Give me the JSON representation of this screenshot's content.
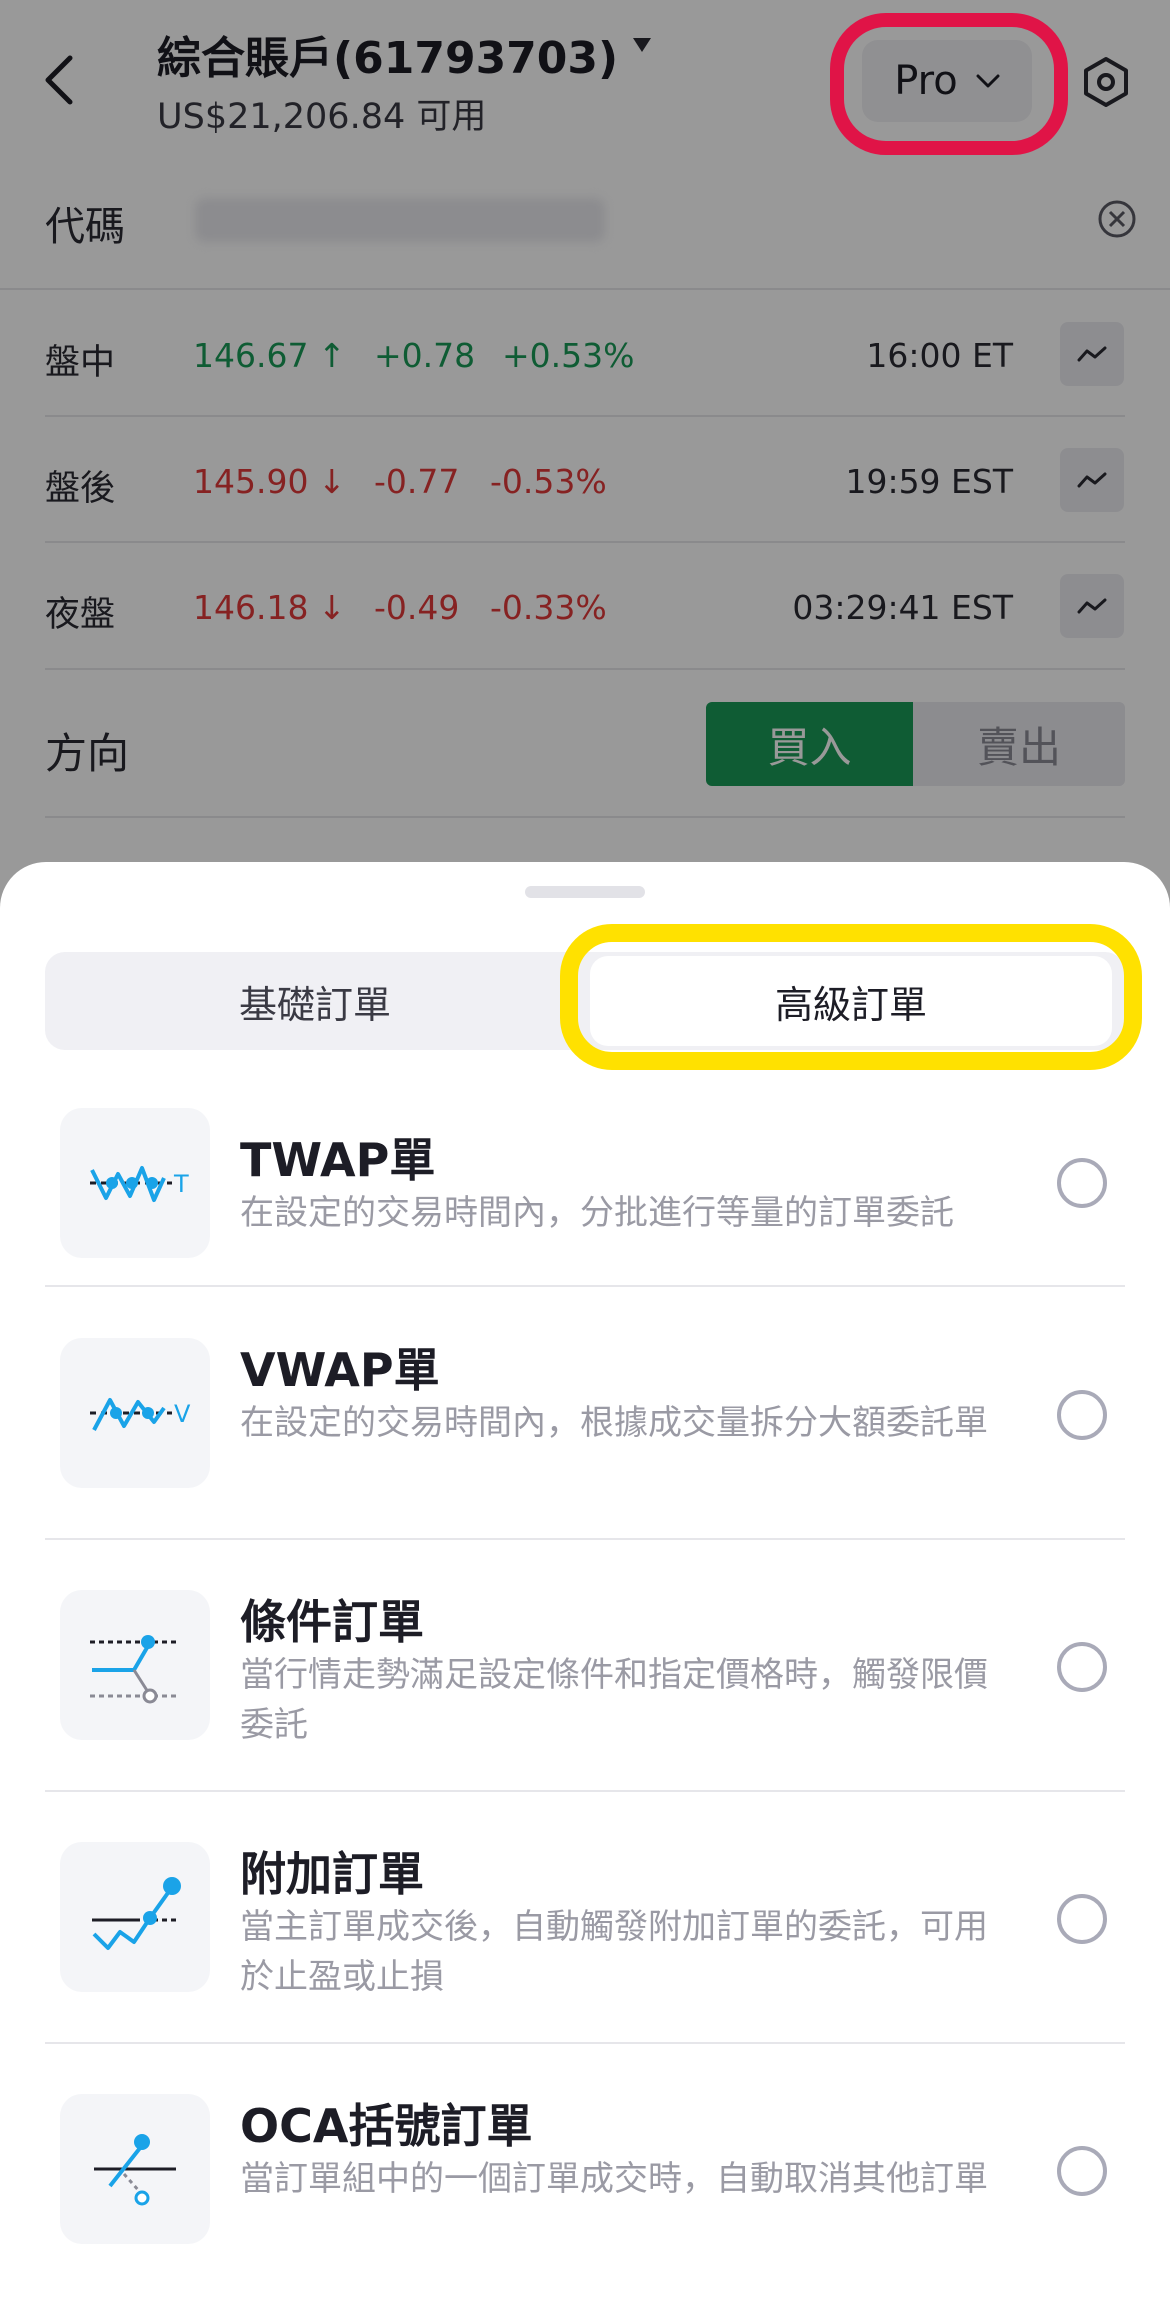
{
  "header": {
    "account_title": "綜合賬戶(61793703)",
    "available": "US$21,206.84 可用",
    "pro_label": "Pro"
  },
  "code": {
    "label": "代碼"
  },
  "sessions": [
    {
      "name": "盤中",
      "price": "146.67",
      "arrow": "↑",
      "change": "+0.78",
      "pct": "+0.53%",
      "time": "16:00 ET",
      "trend": "up"
    },
    {
      "name": "盤後",
      "price": "145.90",
      "arrow": "↓",
      "change": "-0.77",
      "pct": "-0.53%",
      "time": "19:59 EST",
      "trend": "down"
    },
    {
      "name": "夜盤",
      "price": "146.18",
      "arrow": "↓",
      "change": "-0.49",
      "pct": "-0.33%",
      "time": "03:29:41 EST",
      "trend": "down"
    }
  ],
  "direction": {
    "label": "方向",
    "buy": "買入",
    "sell": "賣出"
  },
  "sheet": {
    "tabs": {
      "basic": "基礎訂單",
      "advanced": "高級訂單"
    },
    "orders": [
      {
        "title": "TWAP單",
        "desc": "在設定的交易時間內，分批進行等量的訂單委託",
        "icon": "twap-icon",
        "icon_letter": "T"
      },
      {
        "title": "VWAP單",
        "desc": "在設定的交易時間內，根據成交量拆分大額委託單",
        "icon": "vwap-icon",
        "icon_letter": "V"
      },
      {
        "title": "條件訂單",
        "desc": "當行情走勢滿足設定條件和指定價格時，觸發限價委託",
        "icon": "conditional-order-icon"
      },
      {
        "title": "附加訂單",
        "desc": "當主訂單成交後，自動觸發附加訂單的委託，可用於止盈或止損",
        "icon": "attached-order-icon"
      },
      {
        "title": "OCA括號訂單",
        "desc": "當訂單組中的一個訂單成交時，自動取消其他訂單",
        "icon": "oca-order-icon"
      }
    ]
  },
  "colors": {
    "up": "#1a9a57",
    "down": "#e0393a",
    "accent": "#1aa3e8",
    "highlight_red": "#e01447",
    "highlight_yellow": "#ffe100"
  }
}
